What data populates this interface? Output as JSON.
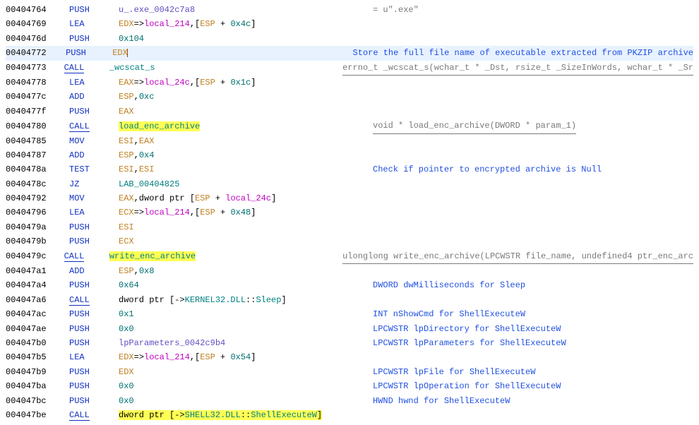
{
  "rows": [
    {
      "addr": "00404764",
      "mnem": "PUSH",
      "op": [
        {
          "t": "u_.exe_0042c7a8",
          "c": "glb"
        }
      ],
      "cmt": "= u\".exe\""
    },
    {
      "addr": "00404769",
      "mnem": "LEA",
      "op": [
        {
          "t": "EDX",
          "c": "reg"
        },
        {
          "t": "=>"
        },
        {
          "t": "local_214",
          "c": "local"
        },
        {
          "t": ",["
        },
        {
          "t": "ESP",
          "c": "reg"
        },
        {
          "t": " + "
        },
        {
          "t": "0x4c",
          "c": "num"
        },
        {
          "t": "]"
        }
      ]
    },
    {
      "addr": "0040476d",
      "mnem": "PUSH",
      "op": [
        {
          "t": "0x104",
          "c": "num"
        }
      ]
    },
    {
      "addr": "00404772",
      "mnem": "PUSH",
      "op": [
        {
          "t": "EDX",
          "c": "reg"
        },
        {
          "t": "",
          "caret": true
        }
      ],
      "cmt": "Store the full file name of executable extracted from PKZIP archive",
      "cblue": true,
      "sel": true
    },
    {
      "addr": "00404773",
      "mnem": "CALL",
      "call": true,
      "op": [
        {
          "t": "_wcscat_s",
          "c": "lbl"
        }
      ],
      "cmt": "errno_t _wcscat_s(wchar_t * _Dst, rsize_t _SizeInWords, wchar_t * _Sr",
      "ccall": true
    },
    {
      "addr": "00404778",
      "mnem": "LEA",
      "op": [
        {
          "t": "EAX",
          "c": "reg"
        },
        {
          "t": "=>"
        },
        {
          "t": "local_24c",
          "c": "local"
        },
        {
          "t": ",["
        },
        {
          "t": "ESP",
          "c": "reg"
        },
        {
          "t": " + "
        },
        {
          "t": "0x1c",
          "c": "num"
        },
        {
          "t": "]"
        }
      ]
    },
    {
      "addr": "0040477c",
      "mnem": "ADD",
      "op": [
        {
          "t": "ESP",
          "c": "reg"
        },
        {
          "t": ","
        },
        {
          "t": "0xc",
          "c": "num"
        }
      ]
    },
    {
      "addr": "0040477f",
      "mnem": "PUSH",
      "op": [
        {
          "t": "EAX",
          "c": "reg"
        }
      ]
    },
    {
      "addr": "00404780",
      "mnem": "CALL",
      "call": true,
      "op": [
        {
          "t": "load_enc_archive",
          "c": "lbl",
          "hl": true
        }
      ],
      "cmt": "void * load_enc_archive(DWORD * param_1)",
      "ccall": true
    },
    {
      "addr": "00404785",
      "mnem": "MOV",
      "op": [
        {
          "t": "ESI",
          "c": "reg"
        },
        {
          "t": ","
        },
        {
          "t": "EAX",
          "c": "reg"
        }
      ]
    },
    {
      "addr": "00404787",
      "mnem": "ADD",
      "op": [
        {
          "t": "ESP",
          "c": "reg"
        },
        {
          "t": ","
        },
        {
          "t": "0x4",
          "c": "num"
        }
      ]
    },
    {
      "addr": "0040478a",
      "mnem": "TEST",
      "op": [
        {
          "t": "ESI",
          "c": "reg"
        },
        {
          "t": ","
        },
        {
          "t": "ESI",
          "c": "reg"
        }
      ],
      "cmt": "Check if pointer to encrypted archive is Null",
      "cblue": true
    },
    {
      "addr": "0040478c",
      "mnem": "JZ",
      "op": [
        {
          "t": "LAB_00404825",
          "c": "lbl"
        }
      ]
    },
    {
      "addr": "00404792",
      "mnem": "MOV",
      "op": [
        {
          "t": "EAX",
          "c": "reg"
        },
        {
          "t": ",dword ptr ["
        },
        {
          "t": "ESP",
          "c": "reg"
        },
        {
          "t": " + "
        },
        {
          "t": "local_24c",
          "c": "local"
        },
        {
          "t": "]"
        }
      ]
    },
    {
      "addr": "00404796",
      "mnem": "LEA",
      "op": [
        {
          "t": "ECX",
          "c": "reg"
        },
        {
          "t": "=>"
        },
        {
          "t": "local_214",
          "c": "local"
        },
        {
          "t": ",["
        },
        {
          "t": "ESP",
          "c": "reg"
        },
        {
          "t": " + "
        },
        {
          "t": "0x48",
          "c": "num"
        },
        {
          "t": "]"
        }
      ]
    },
    {
      "addr": "0040479a",
      "mnem": "PUSH",
      "op": [
        {
          "t": "ESI",
          "c": "reg"
        }
      ]
    },
    {
      "addr": "0040479b",
      "mnem": "PUSH",
      "op": [
        {
          "t": "ECX",
          "c": "reg"
        }
      ]
    },
    {
      "addr": "0040479c",
      "mnem": "CALL",
      "call": true,
      "op": [
        {
          "t": "write_enc_archive",
          "c": "lbl",
          "hl": true
        }
      ],
      "cmt": "ulonglong write_enc_archive(LPCWSTR file_name, undefined4 ptr_enc_arc",
      "ccall": true
    },
    {
      "addr": "004047a1",
      "mnem": "ADD",
      "op": [
        {
          "t": "ESP",
          "c": "reg"
        },
        {
          "t": ","
        },
        {
          "t": "0x8",
          "c": "num"
        }
      ]
    },
    {
      "addr": "004047a4",
      "mnem": "PUSH",
      "op": [
        {
          "t": "0x64",
          "c": "num"
        }
      ],
      "cmt": "DWORD dwMilliseconds for Sleep",
      "cblue": true
    },
    {
      "addr": "004047a6",
      "mnem": "CALL",
      "call": true,
      "op": [
        {
          "t": "dword ptr [->"
        },
        {
          "t": "KERNEL32.DLL",
          "c": "addrref"
        },
        {
          "t": "::"
        },
        {
          "t": "Sleep",
          "c": "addrref"
        },
        {
          "t": "]"
        }
      ]
    },
    {
      "addr": "004047ac",
      "mnem": "PUSH",
      "op": [
        {
          "t": "0x1",
          "c": "num"
        }
      ],
      "cmt": "INT nShowCmd for ShellExecuteW",
      "cblue": true
    },
    {
      "addr": "004047ae",
      "mnem": "PUSH",
      "op": [
        {
          "t": "0x0",
          "c": "num"
        }
      ],
      "cmt": "LPCWSTR lpDirectory for ShellExecuteW",
      "cblue": true
    },
    {
      "addr": "004047b0",
      "mnem": "PUSH",
      "op": [
        {
          "t": "lpParameters_0042c9b4",
          "c": "glb"
        }
      ],
      "cmt": "LPCWSTR lpParameters for ShellExecuteW",
      "cblue": true
    },
    {
      "addr": "004047b5",
      "mnem": "LEA",
      "op": [
        {
          "t": "EDX",
          "c": "reg"
        },
        {
          "t": "=>"
        },
        {
          "t": "local_214",
          "c": "local"
        },
        {
          "t": ",["
        },
        {
          "t": "ESP",
          "c": "reg"
        },
        {
          "t": " + "
        },
        {
          "t": "0x54",
          "c": "num"
        },
        {
          "t": "]"
        }
      ]
    },
    {
      "addr": "004047b9",
      "mnem": "PUSH",
      "op": [
        {
          "t": "EDX",
          "c": "reg"
        }
      ],
      "cmt": "LPCWSTR lpFile for ShellExecuteW",
      "cblue": true
    },
    {
      "addr": "004047ba",
      "mnem": "PUSH",
      "op": [
        {
          "t": "0x0",
          "c": "num"
        }
      ],
      "cmt": "LPCWSTR lpOperation for ShellExecuteW",
      "cblue": true
    },
    {
      "addr": "004047bc",
      "mnem": "PUSH",
      "op": [
        {
          "t": "0x0",
          "c": "num"
        }
      ],
      "cmt": "HWND hwnd for ShellExecuteW",
      "cblue": true
    },
    {
      "addr": "004047be",
      "mnem": "CALL",
      "call": true,
      "op": [
        {
          "t": "dword ptr [->",
          "hl": true
        },
        {
          "t": "SHELL32.DLL",
          "c": "addrref",
          "hl": true
        },
        {
          "t": "::",
          "hl": true
        },
        {
          "t": "ShellExecuteW",
          "c": "addrref",
          "hl": true
        },
        {
          "t": "]",
          "hl": true
        }
      ]
    }
  ]
}
